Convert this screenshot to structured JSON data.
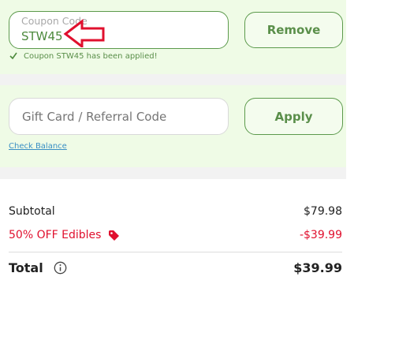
{
  "coupon": {
    "label": "Coupon Code",
    "value": "STW45",
    "remove_label": "Remove",
    "status_icon": "check-icon",
    "status_text": "Coupon STW45 has been applied!"
  },
  "gift": {
    "placeholder": "Gift Card / Referral Code",
    "apply_label": "Apply",
    "check_balance_label": "Check Balance"
  },
  "summary": {
    "subtotal_label": "Subtotal",
    "subtotal_value": "$79.98",
    "discount_label": "50% OFF Edibles",
    "discount_icon": "tag-icon",
    "discount_value": "-$39.99",
    "total_label": "Total",
    "total_icon": "info-icon",
    "total_value": "$39.99"
  },
  "colors": {
    "accent_green": "#5a8f4a",
    "panel_bg": "#effbe6",
    "discount_red": "#e0102e",
    "annotation_arrow": "#e0102e"
  }
}
